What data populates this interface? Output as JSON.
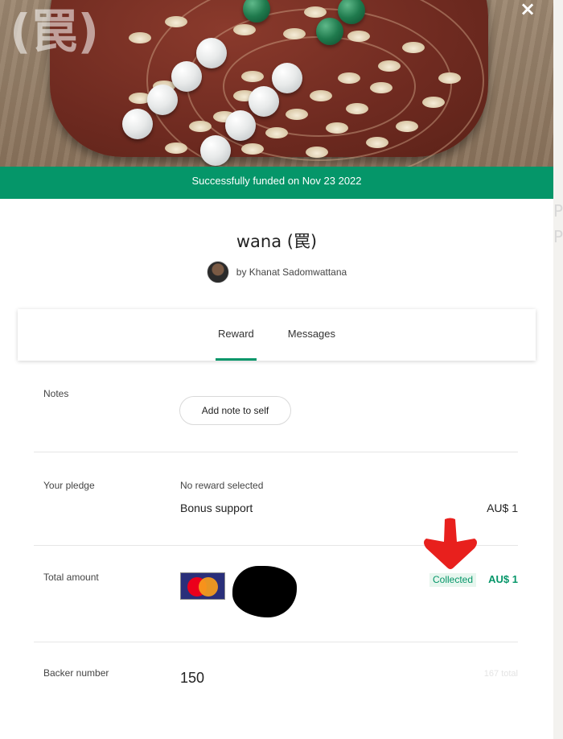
{
  "hero": {
    "watermark": "(罠)"
  },
  "close_label": "×",
  "banner": {
    "text": "Successfully funded on Nov 23 2022"
  },
  "project": {
    "title": "wana (罠)",
    "creator": "by Khanat Sadomwattana"
  },
  "tabs": [
    {
      "label": "Reward",
      "active": true
    },
    {
      "label": "Messages",
      "active": false
    }
  ],
  "notes": {
    "label": "Notes",
    "button_label": "Add note to self"
  },
  "pledge": {
    "label": "Your pledge",
    "reward": "No reward selected",
    "bonus_label": "Bonus support",
    "bonus_value": "AU$ 1"
  },
  "total": {
    "label": "Total amount",
    "status": "Collected",
    "value": "AU$ 1",
    "card_brand_icon": "mastercard-icon"
  },
  "backer": {
    "label": "Backer number",
    "value": "150",
    "total_text": "167 total"
  },
  "colors": {
    "accent": "#059669",
    "annotation_arrow": "#e8201d"
  }
}
